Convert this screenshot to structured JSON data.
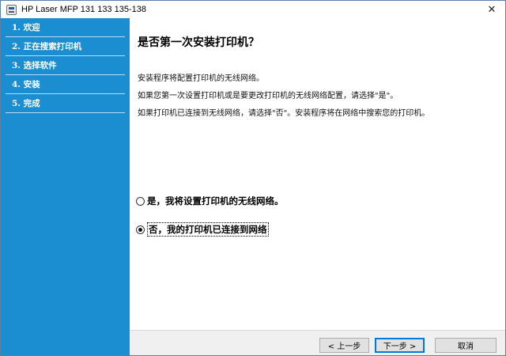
{
  "window": {
    "title": "HP Laser MFP 131 133 135-138",
    "close_glyph": "✕"
  },
  "sidebar": {
    "steps": [
      {
        "label": "1. 欢迎"
      },
      {
        "label": "2. 正在搜索打印机"
      },
      {
        "label": "3. 选择软件"
      },
      {
        "label": "4. 安装"
      },
      {
        "label": "5. 完成"
      }
    ]
  },
  "main": {
    "heading": "是否第一次安装打印机？",
    "paragraphs": [
      "安装程序将配置打印机的无线网络。",
      "如果您第一次设置打印机或是要更改打印机的无线网络配置，请选择\"是\"。",
      "如果打印机已连接到无线网络，请选择\"否\"。安装程序将在网络中搜索您的打印机。"
    ],
    "options": [
      {
        "label": "是，我将设置打印机的无线网络。",
        "checked": false
      },
      {
        "label": "否，我的打印机已连接到网络",
        "checked": true
      }
    ]
  },
  "footer": {
    "back_label": "< 上一步",
    "next_label": "下一步 >",
    "cancel_label": "取消"
  },
  "colors": {
    "sidebar_bg": "#1a8ed0",
    "accent": "#0078d7"
  },
  "icons": {
    "app": "printer-app-icon",
    "close": "close-icon",
    "radio": "radio-button-icon"
  }
}
